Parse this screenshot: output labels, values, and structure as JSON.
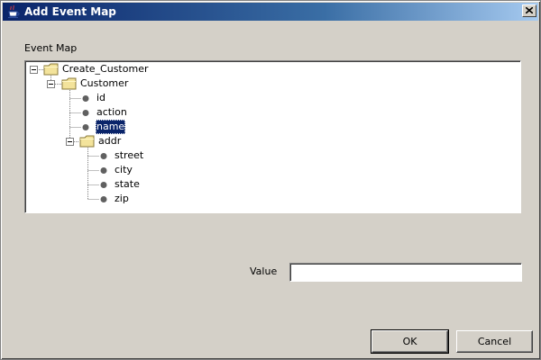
{
  "window": {
    "title": "Add Event Map",
    "icon": "java-coffee-icon",
    "close_icon": "close-icon"
  },
  "event_map": {
    "label": "Event Map",
    "tree": {
      "root": "Create_Customer",
      "customer": "Customer",
      "id": "id",
      "action": "action",
      "name": "name",
      "addr": "addr",
      "street": "street",
      "city": "city",
      "state": "state",
      "zip": "zip",
      "selected": "name",
      "folder_color": "#f3e39b",
      "leaf_color": "#606060",
      "selection_color": "#0a246a"
    }
  },
  "value": {
    "label": "Value",
    "current": "",
    "placeholder": ""
  },
  "buttons": {
    "ok": "OK",
    "cancel": "Cancel"
  }
}
